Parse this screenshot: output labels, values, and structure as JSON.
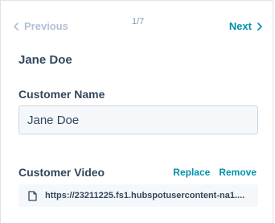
{
  "pager": {
    "previous_label": "Previous",
    "next_label": "Next",
    "counter": "1/7"
  },
  "contact": {
    "name": "Jane Doe"
  },
  "fields": {
    "customer_name": {
      "label": "Customer Name",
      "value": "Jane Doe"
    },
    "customer_video": {
      "label": "Customer Video",
      "replace_label": "Replace",
      "remove_label": "Remove",
      "file_url": "https://23211225.fs1.hubspotusercontent-na1...."
    }
  },
  "colors": {
    "accent": "#0091ae",
    "text": "#33475b",
    "disabled": "#b0c1d4",
    "input_bg": "#f5f8fa",
    "border": "#cbd6e2"
  },
  "icons": {
    "prev": "chevron-left-icon",
    "next": "chevron-right-icon",
    "file": "file-icon"
  }
}
